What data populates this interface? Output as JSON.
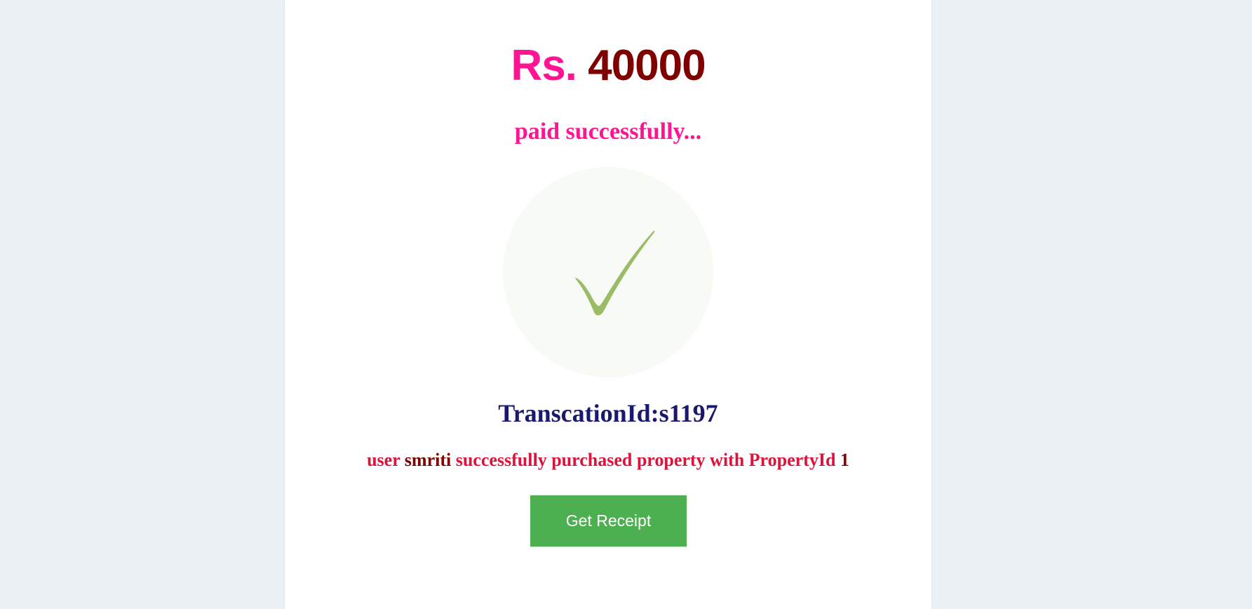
{
  "payment": {
    "currency": "Rs.",
    "amount": "40000",
    "status_text": "paid successfully...",
    "transaction_label": "TranscationId:",
    "transaction_id": "s1197",
    "message_prefix": "user ",
    "username": "smriti",
    "message_middle": " successfully purchased property with PropertyId ",
    "property_id": "1",
    "receipt_button_label": "Get Receipt"
  },
  "icons": {
    "status": "checkmark-icon"
  },
  "colors": {
    "background": "#ebf0f5",
    "card": "#ffffff",
    "currency": "#ff1493",
    "amount": "#800000",
    "status_text": "#ff1493",
    "check_circle": "#f8faf5",
    "checkmark": "#9abc66",
    "transaction": "#191970",
    "message": "#dc143c",
    "username": "#800000",
    "property_id": "#8b0000",
    "button": "#4caf50",
    "button_text": "#ffffff"
  }
}
